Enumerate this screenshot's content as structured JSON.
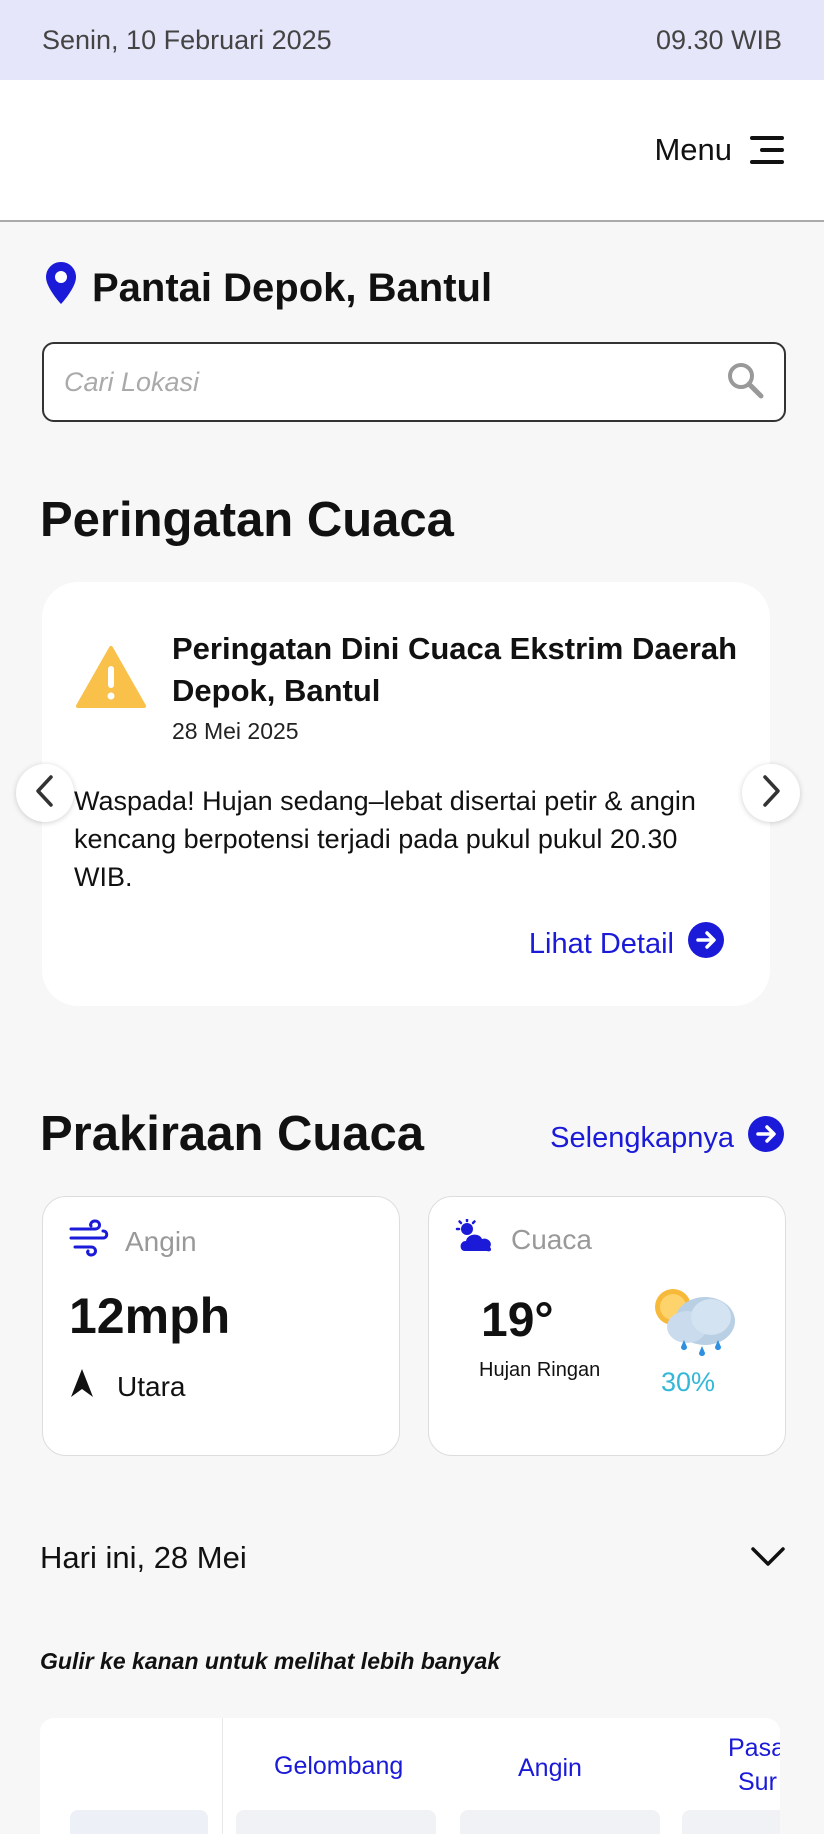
{
  "status_bar": {
    "date": "Senin, 10 Februari 2025",
    "time": "09.30 WIB"
  },
  "header": {
    "menu_label": "Menu"
  },
  "location": {
    "name": "Pantai Depok, Bantul"
  },
  "search": {
    "placeholder": "Cari Lokasi"
  },
  "warning": {
    "section_title": "Peringatan Cuaca",
    "card": {
      "title": "Peringatan Dini Cuaca Ekstrim Daerah Depok, Bantul",
      "date": "28 Mei 2025",
      "body": "Waspada! Hujan sedang–lebat disertai petir & angin kencang berpotensi terjadi pada pukul pukul 20.30 WIB.",
      "detail_link": "Lihat Detail"
    }
  },
  "forecast": {
    "section_title": "Prakiraan Cuaca",
    "more_link": "Selengkapnya",
    "wind": {
      "label": "Angin",
      "speed": "12mph",
      "direction": "Utara"
    },
    "weather": {
      "label": "Cuaca",
      "temperature": "19°",
      "condition": "Hujan Ringan",
      "precipitation": "30%"
    }
  },
  "daily": {
    "day_label": "Hari ini, 28 Mei",
    "scroll_hint": "Gulir ke kanan untuk melihat lebih banyak",
    "columns": [
      "Gelombang",
      "Angin",
      "Pasa",
      "Sur"
    ]
  },
  "colors": {
    "accent": "#1a1ad8",
    "warning": "#f9c04a",
    "status_bg": "#e6e6fb",
    "precip": "#35b8d8"
  }
}
